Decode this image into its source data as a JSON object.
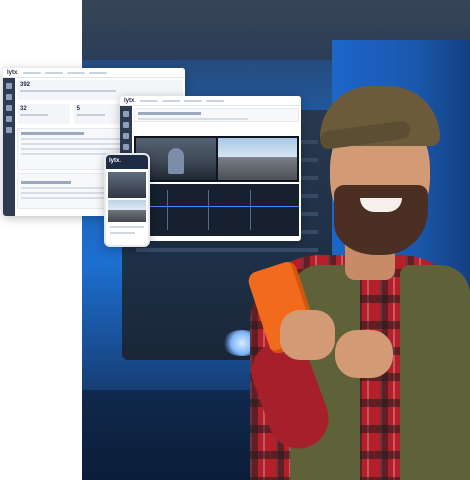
{
  "hero": {
    "dashboard_logo": "lytx",
    "left_window_stats": [
      "392",
      "32",
      "5",
      "0"
    ],
    "phone_logo": "lytx"
  },
  "colors": {
    "truck_blue": "#1c6fd0",
    "phone_orange": "#f26a1b",
    "shirt_red": "#b3202a",
    "vest_olive": "#5f6138",
    "sidebar_navy": "#2d3a4f"
  }
}
